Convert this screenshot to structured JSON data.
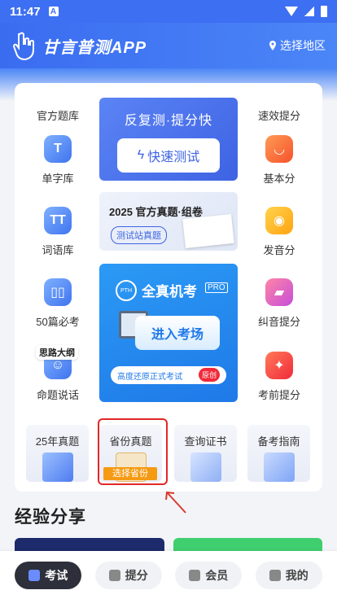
{
  "status": {
    "time": "11:47",
    "notif_icon": "A"
  },
  "header": {
    "title": "甘言普测APP",
    "region_label": "选择地区"
  },
  "left_col": {
    "title": "官方题库",
    "items": [
      {
        "label": "单字库",
        "glyph": "T"
      },
      {
        "label": "词语库",
        "glyph": "TT"
      },
      {
        "label": "50篇必考",
        "glyph": "▯▯"
      },
      {
        "label": "命题说话",
        "glyph": "☺"
      }
    ],
    "tag": "思路大纲"
  },
  "right_col": {
    "title": "速效提分",
    "items": [
      {
        "label": "基本分"
      },
      {
        "label": "发音分"
      },
      {
        "label": "纠音提分"
      },
      {
        "label": "考前提分"
      }
    ]
  },
  "banner1": {
    "title": "反复测·提分快",
    "button": "快速测试"
  },
  "banner2": {
    "title": "2025 官方真题·组卷",
    "button": "测试站真题"
  },
  "banner3": {
    "badge": "PTH",
    "title": "全真机考",
    "pro": "PRO",
    "button": "进入考场",
    "subtitle": "高度还原正式考试",
    "orig": "原创"
  },
  "tiles": [
    {
      "label": "25年真题"
    },
    {
      "label": "省份真题",
      "tag": "选择省份"
    },
    {
      "label": "查询证书"
    },
    {
      "label": "备考指南"
    }
  ],
  "section": {
    "title": "经验分享"
  },
  "tabs": [
    {
      "label": "考试",
      "active": true
    },
    {
      "label": "提分",
      "active": false
    },
    {
      "label": "会员",
      "active": false
    },
    {
      "label": "我的",
      "active": false
    }
  ]
}
